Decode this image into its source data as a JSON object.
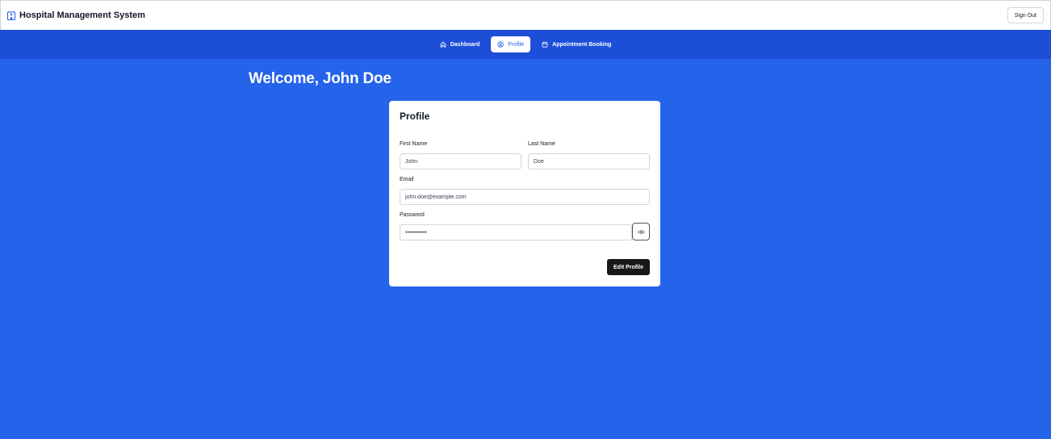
{
  "header": {
    "title": "Hospital Management System",
    "logo_icon": "hospital-building-icon",
    "sign_out_label": "Sign Out"
  },
  "nav": {
    "items": [
      {
        "label": "Dashboard",
        "icon": "home-icon",
        "active": false
      },
      {
        "label": "Profile",
        "icon": "user-circle-icon",
        "active": true
      },
      {
        "label": "Appointment Booking",
        "icon": "calendar-icon",
        "active": false
      }
    ]
  },
  "main": {
    "welcome": "Welcome, John Doe"
  },
  "profile": {
    "title": "Profile",
    "first_name": {
      "label": "First Name",
      "value": "John"
    },
    "last_name": {
      "label": "Last Name",
      "value": "Doe"
    },
    "email": {
      "label": "Email",
      "value": "john.doe@example.com"
    },
    "password": {
      "label": "Password",
      "value": "password123"
    },
    "edit_label": "Edit Profile"
  },
  "colors": {
    "background": "#2563eb",
    "nav_background": "#1d4ed8",
    "card": "#ffffff",
    "primary_button": "#18181b"
  }
}
